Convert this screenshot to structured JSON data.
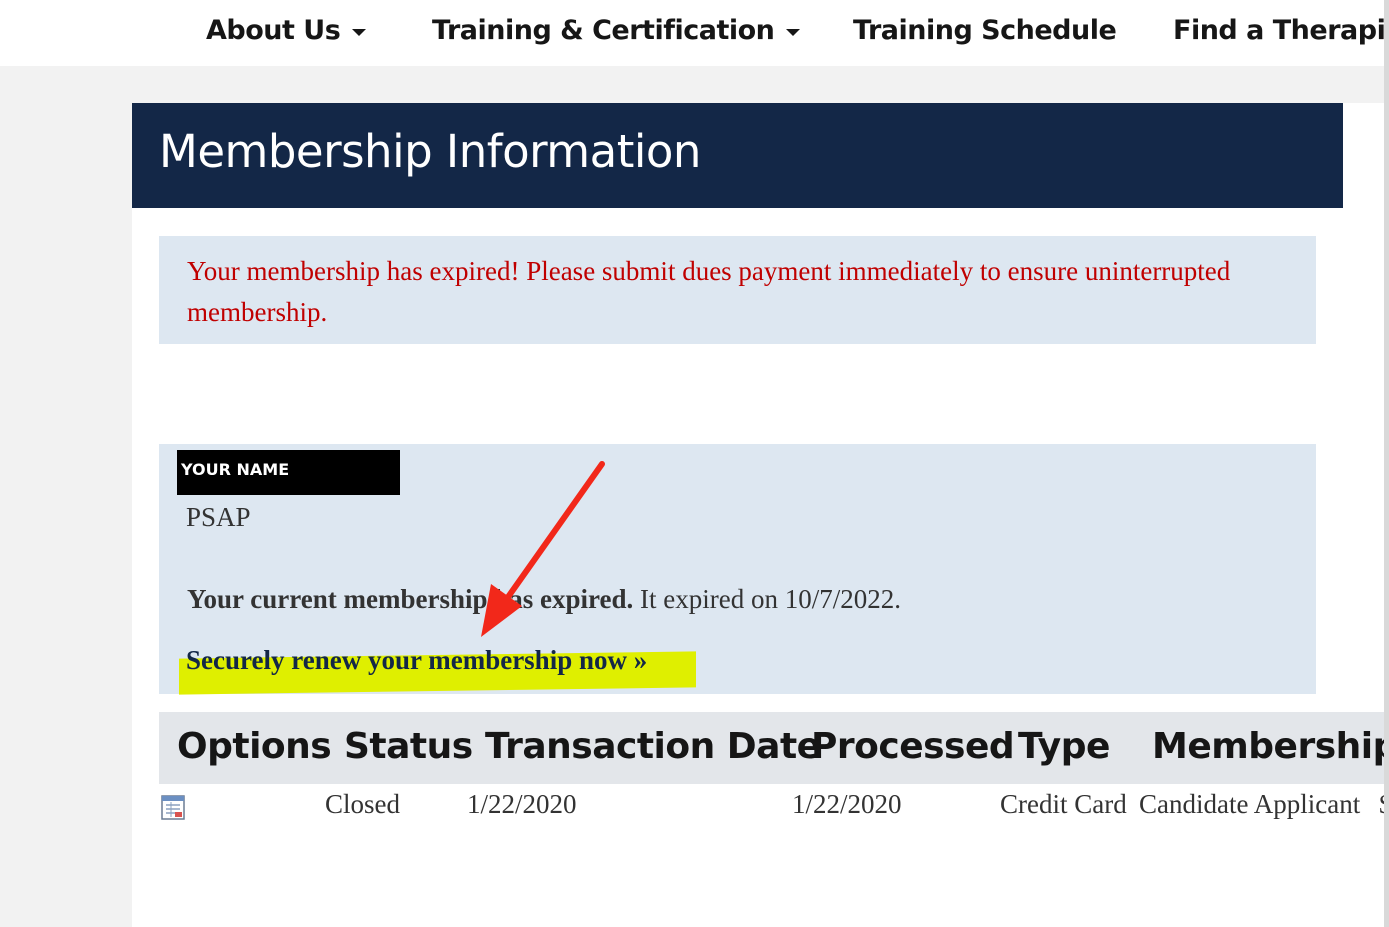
{
  "nav": {
    "items": [
      {
        "label": "About Us",
        "dropdown": true
      },
      {
        "label": "Training & Certification",
        "dropdown": true
      },
      {
        "label": "Training Schedule",
        "dropdown": false
      },
      {
        "label": "Find a Therapis",
        "dropdown": false
      }
    ]
  },
  "page": {
    "title": "Membership Information"
  },
  "alert": {
    "message": "Your membership has expired! Please submit dues payment immediately to ensure uninterrupted membership."
  },
  "member": {
    "name_redacted": "YOUR NAME",
    "organization": "PSAP",
    "status_bold": "Your current membership has expired.",
    "status_rest": " It expired on 10/7/2022.",
    "renew_link": "Securely renew your membership now »"
  },
  "table": {
    "headers": [
      "Options",
      "Status",
      "Transaction Date",
      "Processed",
      "Type",
      "Membership"
    ],
    "rows": [
      {
        "option_icon": "calendar-icon",
        "status": "Closed",
        "transaction_date": "1/22/2020",
        "processed": "1/22/2020",
        "type": "Credit Card",
        "membership": "Candidate Applicant",
        "overflow": "$"
      }
    ]
  },
  "colors": {
    "header_bg": "#132747",
    "alert_text": "#c00000",
    "panel_bg": "#dde7f1",
    "highlight": "#dfef00",
    "annotation_arrow": "#f2281a"
  },
  "annotation": {
    "arrow_icon": "red-arrow-icon"
  }
}
